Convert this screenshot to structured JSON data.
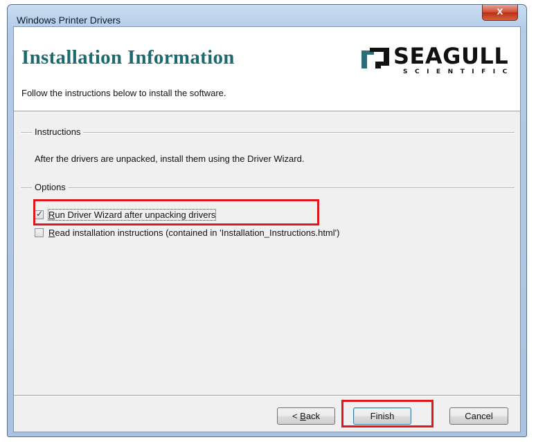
{
  "window": {
    "title": "Windows Printer Drivers",
    "close_glyph": "x"
  },
  "header": {
    "title": "Installation Information",
    "subtitle": "Follow the instructions below to install the software.",
    "logo_word": "SEAGULL",
    "logo_sub": "SCIENTIFIC",
    "logo_icon": "seagull-logo-mark"
  },
  "instructions": {
    "group_title": "Instructions",
    "text": "After the drivers are unpacked, install them using the Driver Wizard."
  },
  "options": {
    "group_title": "Options",
    "run_wizard": {
      "mnemonic": "R",
      "label_rest": "un Driver Wizard after unpacking drivers",
      "checked": true
    },
    "read_instructions": {
      "mnemonic": "R",
      "label_rest": "ead installation instructions (contained in 'Installation_Instructions.html')",
      "checked": false
    }
  },
  "buttons": {
    "back_prefix": "< ",
    "back_mnemonic": "B",
    "back_rest": "ack",
    "finish": "Finish",
    "cancel": "Cancel"
  },
  "colors": {
    "highlight": "#e0161b",
    "title_teal": "#1d6a6e",
    "close_red": "#c7452c"
  }
}
